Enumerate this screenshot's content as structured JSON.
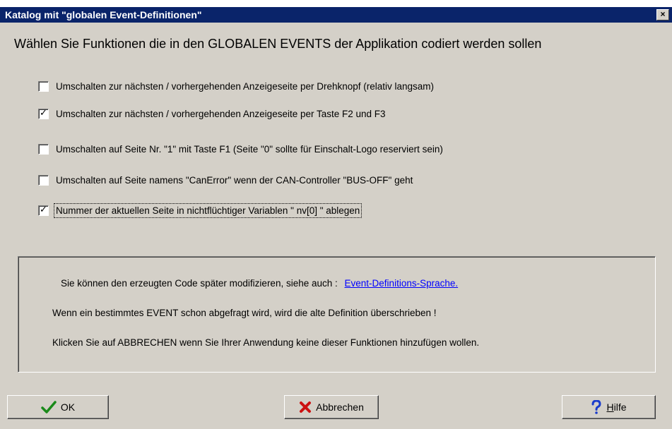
{
  "window": {
    "title": "Katalog mit \"globalen Event-Definitionen\"",
    "close_label": "×"
  },
  "heading": "Wählen Sie Funktionen die in den GLOBALEN EVENTS der Applikation codiert werden sollen",
  "options": [
    {
      "label": "Umschalten zur nächsten / vorhergehenden Anzeigeseite per Drehknopf (relativ langsam)",
      "checked": false
    },
    {
      "label": "Umschalten zur nächsten / vorhergehenden Anzeigeseite per Taste F2 und F3",
      "checked": true
    },
    {
      "label": "Umschalten auf Seite Nr. \"1\" mit Taste F1 (Seite \"0\" sollte für Einschalt-Logo reserviert sein)",
      "checked": false
    },
    {
      "label": "Umschalten auf Seite namens \"CanError\" wenn der CAN-Controller \"BUS-OFF\" geht",
      "checked": false
    },
    {
      "label": "Nummer der aktuellen Seite in nichtflüchtiger Variablen \" nv[0] \" ablegen",
      "checked": true
    }
  ],
  "info": {
    "line1": "Sie können den erzeugten Code später modifizieren, siehe auch :",
    "link": "Event-Definitions-Sprache.",
    "line2": "Wenn ein bestimmtes EVENT schon abgefragt wird, wird die alte Definition überschrieben !",
    "line3": "Klicken Sie auf ABBRECHEN wenn Sie Ihrer Anwendung keine dieser Funktionen hinzufügen wollen."
  },
  "buttons": {
    "ok": "OK",
    "cancel": "Abbrechen",
    "help_underlined": "H",
    "help_rest": "ilfe"
  },
  "colors": {
    "titlebar": "#0a246a",
    "dialog": "#d4d0c8",
    "ok_icon": "#1a8a1a",
    "cancel_icon": "#cc1111",
    "help_icon": "#1a3ccc",
    "link": "#0000ff"
  },
  "icons": {
    "ok": "checkmark-icon",
    "cancel": "x-icon",
    "help": "question-mark-icon",
    "close": "close-icon"
  }
}
